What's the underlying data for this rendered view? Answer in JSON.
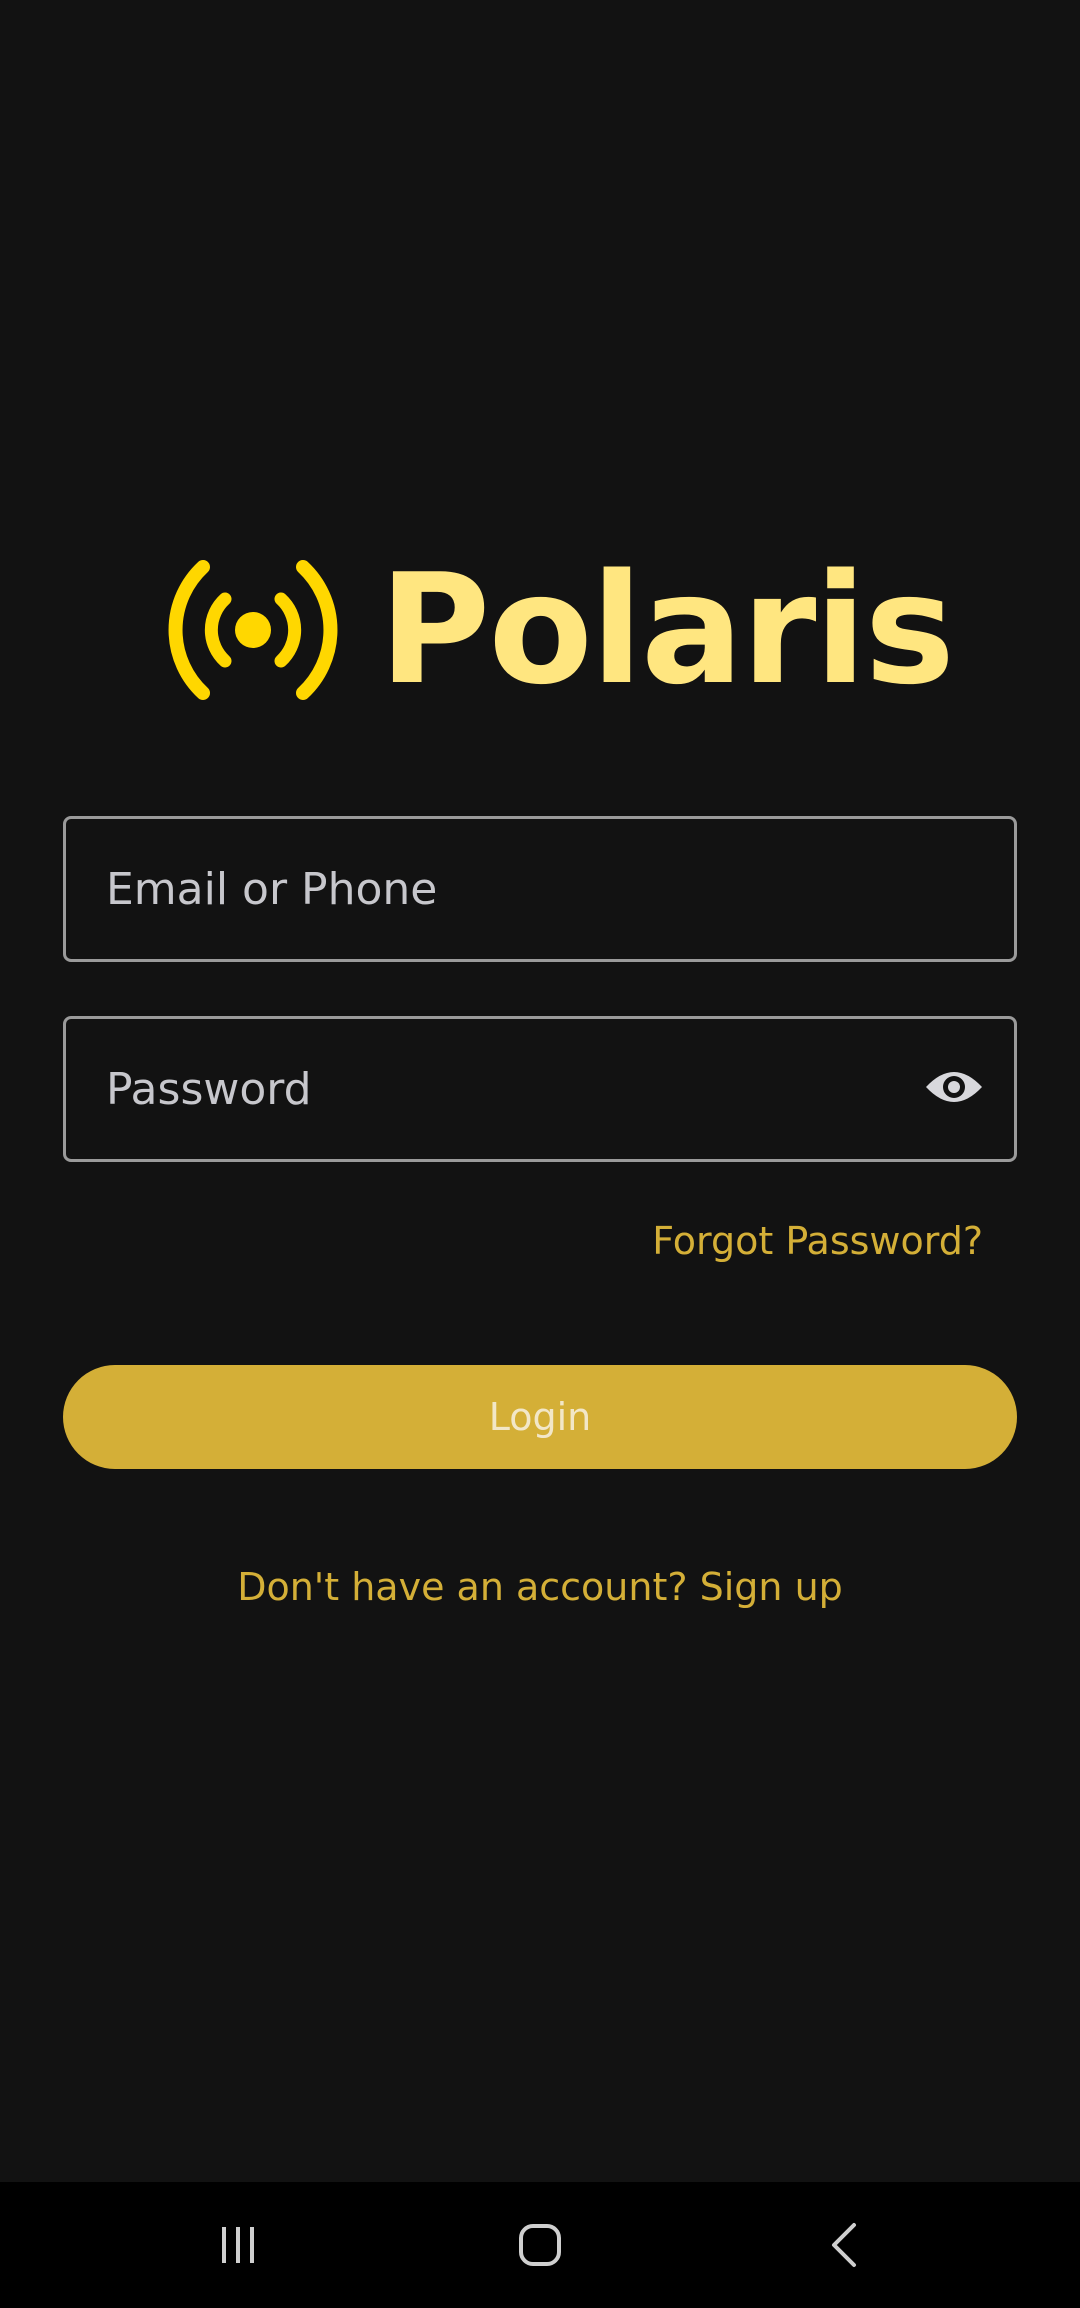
{
  "logo": {
    "text": "Polaris",
    "icon": "broadcast-icon",
    "icon_color": "#FFD700",
    "text_color": "#FFE680"
  },
  "form": {
    "email_placeholder": "Email or Phone",
    "email_value": "",
    "password_placeholder": "Password",
    "password_value": "",
    "forgot_label": "Forgot Password?",
    "login_label": "Login",
    "signup_label": "Don't have an account? Sign up"
  },
  "nav": {
    "recents_icon": "recents-icon",
    "home_icon": "home-icon",
    "back_icon": "back-icon"
  },
  "colors": {
    "background": "#121212",
    "accent": "#D4AF37",
    "field_border": "#9A9A9A",
    "navbar": "#000000"
  }
}
